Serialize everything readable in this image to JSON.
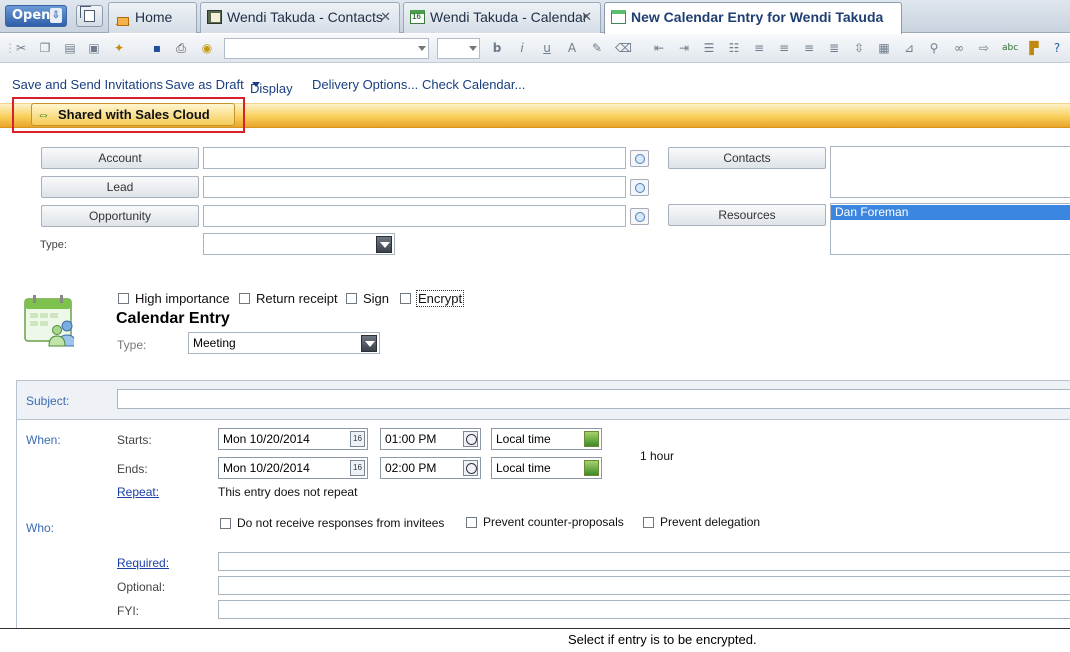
{
  "tabbar": {
    "open_label": "Open",
    "tabs": [
      {
        "label": "Home",
        "icon": "home-icon"
      },
      {
        "label": "Wendi Takuda - Contacts",
        "icon": "contacts-icon"
      },
      {
        "label": "Wendi Takuda - Calendar",
        "icon": "calendar-icon"
      },
      {
        "label": "New Calendar Entry for Wendi Takuda",
        "icon": "calendar-entry-icon",
        "active": true
      }
    ],
    "close_glyph": "✕"
  },
  "actions": {
    "save_send": "Save and Send Invitations",
    "save_draft": "Save as Draft",
    "display": "Display",
    "delivery": "Delivery Options...",
    "check_calendar": "Check Calendar..."
  },
  "shared": {
    "label": "Shared with Sales Cloud",
    "icon": "sync-arrows-icon"
  },
  "crm": {
    "account_label": "Account",
    "lead_label": "Lead",
    "opportunity_label": "Opportunity",
    "type_label": "Type:",
    "contacts_label": "Contacts",
    "resources_label": "Resources",
    "resources_value": "Dan Foreman"
  },
  "options": {
    "high_importance": "High importance",
    "return_receipt": "Return receipt",
    "sign": "Sign",
    "encrypt": "Encrypt"
  },
  "entry": {
    "heading": "Calendar Entry",
    "type_label": "Type:",
    "type_value": "Meeting"
  },
  "form": {
    "subject_label": "Subject:",
    "when_label": "When:",
    "starts_label": "Starts:",
    "ends_label": "Ends:",
    "start_date": "Mon 10/20/2014",
    "start_time": "01:00 PM",
    "start_tz": "Local time",
    "end_date": "Mon 10/20/2014",
    "end_time": "02:00 PM",
    "end_tz": "Local time",
    "duration": "1 hour",
    "repeat_label": "Repeat:",
    "repeat_text": "This entry does not repeat",
    "who_label": "Who:",
    "no_responses": "Do not receive responses from invitees",
    "prevent_counter": "Prevent counter-proposals",
    "prevent_delegation": "Prevent delegation",
    "required_label": "Required:",
    "optional_label": "Optional:",
    "fyi_label": "FYI:",
    "date_picker_glyph": "16"
  },
  "status": {
    "text": "Select if entry is to be encrypted."
  },
  "colors": {
    "accent_bar": "#f8cf5a",
    "highlight": "#3b86e0",
    "link": "#1a3fa8",
    "annotation": "#d8202a"
  }
}
